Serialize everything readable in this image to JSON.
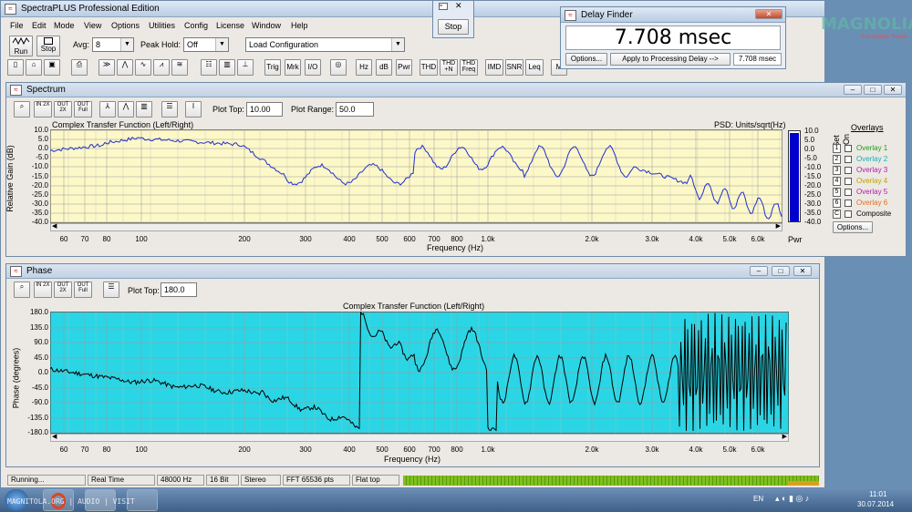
{
  "app": {
    "title": "SpectraPLUS Professional Edition"
  },
  "menu": [
    "File",
    "Edit",
    "Mode",
    "View",
    "Options",
    "Utilities",
    "Config",
    "License",
    "Window",
    "Help"
  ],
  "toolbar": {
    "run_label": "Run",
    "stop_label": "Stop",
    "avg_label": "Avg:",
    "avg_value": "8",
    "peakhold_label": "Peak Hold:",
    "peakhold_value": "Off",
    "config_value": "Load Configuration",
    "buttons": [
      "Trig",
      "Mrk",
      "I/O",
      "Hz",
      "dB",
      "Pwr",
      "THD",
      "THD +N",
      "THD Freq",
      "IMD",
      "SNR",
      "Leq",
      "M"
    ]
  },
  "stop_popup": {
    "button": "Stop"
  },
  "delay_finder": {
    "title": "Delay Finder",
    "value": "7.708 msec",
    "options_label": "Options...",
    "apply_label": "Apply to Processing Delay -->",
    "apply_value": "7.708 msec"
  },
  "watermark": {
    "text": "MAGNOLIA",
    "sub": "CarAudio Team"
  },
  "spectrum": {
    "title": "Spectrum",
    "plot_top_label": "Plot Top:",
    "plot_top_value": "10.00",
    "plot_range_label": "Plot Range:",
    "plot_range_value": "50.0",
    "heading": "Complex Transfer Function (Left/Right)",
    "psd_label": "PSD: Units/sqrt(Hz)",
    "ylabel": "Relative Gain (dB)",
    "xlabel": "Frequency (Hz)",
    "pwr_label": "Pwr",
    "yticks": [
      "10.0",
      "5.0",
      "0.0",
      "-5.0",
      "-10.0",
      "-15.0",
      "-20.0",
      "-25.0",
      "-30.0",
      "-35.0",
      "-40.0"
    ],
    "xticks": [
      "60",
      "70",
      "80",
      "100",
      "200",
      "300",
      "400",
      "500",
      "600",
      "700",
      "800",
      "1.0k",
      "2.0k",
      "3.0k",
      "4.0k",
      "5.0k",
      "6.0k"
    ],
    "meter_ticks": [
      "10.0",
      "5.0",
      "0.0",
      "-5.0",
      "-10.0",
      "-15.0",
      "-20.0",
      "-25.0",
      "-30.0",
      "-35.0",
      "-40.0"
    ],
    "overlays_title": "Overlays",
    "set_label": "Set",
    "on_label": "On",
    "overlays": [
      {
        "num": "1",
        "name": "Overlay 1",
        "color": "#1aa01a"
      },
      {
        "num": "2",
        "name": "Overlay 2",
        "color": "#1ab0b0"
      },
      {
        "num": "3",
        "name": "Overlay 3",
        "color": "#b01ab0"
      },
      {
        "num": "4",
        "name": "Overlay 4",
        "color": "#c0a000"
      },
      {
        "num": "5",
        "name": "Overlay 5",
        "color": "#b01ab0"
      },
      {
        "num": "6",
        "name": "Overlay 6",
        "color": "#e07020"
      },
      {
        "num": "C",
        "name": "Composite",
        "color": "#000000"
      }
    ],
    "options_label": "Options..."
  },
  "phase": {
    "title": "Phase",
    "plot_top_label": "Plot Top:",
    "plot_top_value": "180.0",
    "heading": "Complex Transfer Function (Left/Right)",
    "ylabel": "Phase (degrees)",
    "xlabel": "Frequency (Hz)",
    "yticks": [
      "180.0",
      "135.0",
      "90.0",
      "45.0",
      "0.0",
      "-45.0",
      "-90.0",
      "-135.0",
      "-180.0"
    ],
    "xticks": [
      "60",
      "70",
      "80",
      "100",
      "200",
      "300",
      "400",
      "500",
      "600",
      "700",
      "800",
      "1.0k",
      "2.0k",
      "3.0k",
      "4.0k",
      "5.0k",
      "6.0k"
    ]
  },
  "status": {
    "running": "Running...",
    "mode": "Real Time",
    "rate": "48000 Hz",
    "bits": "16 Bit",
    "channels": "Stereo",
    "fft": "FFT 65536 pts",
    "window": "Flat top"
  },
  "taskbar": {
    "lang": "EN",
    "time": "11:01",
    "date": "30.07.2014",
    "watermark": "MAGNITOLA.ORG | AUDIO | VISIT"
  },
  "colors": {
    "spectrum_bg": "#fdf8c8",
    "spectrum_line": "#1f2fd0",
    "phase_bg": "#2ad6e6",
    "phase_line": "#000000",
    "meter_fill": "#0000cc",
    "level_bar": "#7fbf1f"
  }
}
